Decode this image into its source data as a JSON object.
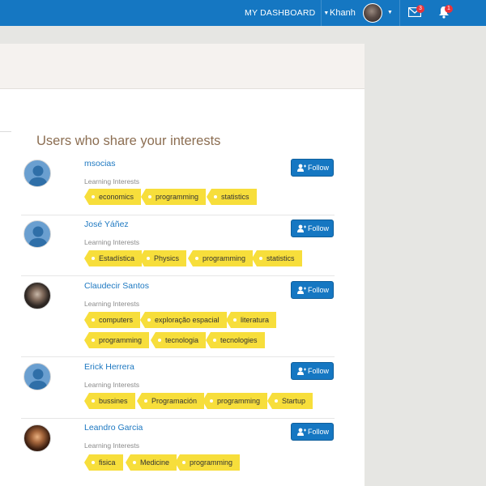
{
  "navbar": {
    "dashboard_label": "MY DASHBOARD",
    "caret": "▼",
    "user_name": "Khanh",
    "mail_count": "3",
    "notification_count": "1"
  },
  "section": {
    "title": "Users who share your interests"
  },
  "learning_label": "Learning Interests",
  "follow_label": "Follow",
  "users": [
    {
      "name": "msocias",
      "avatar": "default",
      "interests": [
        "economics",
        "programming",
        "statistics"
      ]
    },
    {
      "name": "José Yáñez",
      "avatar": "default",
      "interests": [
        "Estadística",
        "Physics",
        "programming",
        "statistics"
      ]
    },
    {
      "name": "Claudecir Santos",
      "avatar": "photo",
      "interests": [
        "computers",
        "exploração espacial",
        "literatura",
        "programming",
        "tecnologia",
        "tecnologies"
      ]
    },
    {
      "name": "Erick Herrera",
      "avatar": "default",
      "interests": [
        "bussines",
        "Programación",
        "programming",
        "Startup"
      ]
    },
    {
      "name": "Leandro Garcia",
      "avatar": "photo",
      "interests": [
        "fisica",
        "Medicine",
        "programming"
      ]
    }
  ],
  "colors": {
    "nav_blue": "#1577c2",
    "tag_yellow": "#f7de3b",
    "title_brown": "#8c6e52",
    "link_blue": "#1d78c1"
  }
}
